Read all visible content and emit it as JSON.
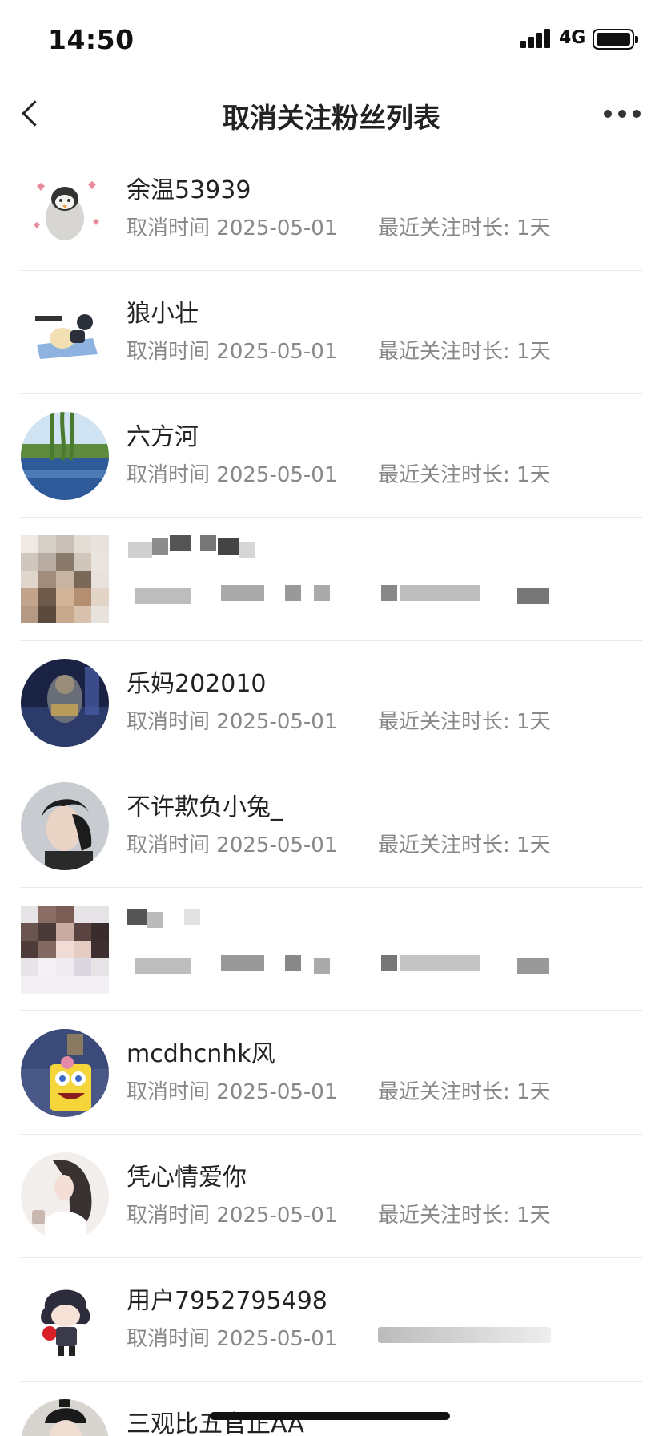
{
  "status_bar": {
    "time": "14:50",
    "network": "4G"
  },
  "nav": {
    "title": "取消关注粉丝列表"
  },
  "unfollow_label": "取消时间",
  "followers": [
    {
      "name": "余温53939",
      "date": "2025-05-01",
      "duration": "最近关注时长: 1天",
      "avatar_icon": "penguin-sticker"
    },
    {
      "name": "狼小壮",
      "date": "2025-05-01",
      "duration": "最近关注时长: 1天",
      "avatar_icon": "cartoon-sticker"
    },
    {
      "name": "六方河",
      "date": "2025-05-01",
      "duration": "最近关注时长: 1天",
      "avatar_icon": "lake-photo"
    },
    {
      "name": "",
      "date": "",
      "duration": "",
      "avatar_icon": "pixelated-avatar"
    },
    {
      "name": "乐妈202010",
      "date": "2025-05-01",
      "duration": "最近关注时长: 1天",
      "avatar_icon": "game-character"
    },
    {
      "name": "不许欺负小兔_",
      "date": "2025-05-01",
      "duration": "最近关注时长: 1天",
      "avatar_icon": "portrait-photo"
    },
    {
      "name": "",
      "date": "",
      "duration": "",
      "avatar_icon": "pixelated-avatar"
    },
    {
      "name": "mcdhcnhk风",
      "date": "2025-05-01",
      "duration": "最近关注时长: 1天",
      "avatar_icon": "spongebob-avatar"
    },
    {
      "name": "凭心情爱你",
      "date": "2025-05-01",
      "duration": "最近关注时长: 1天",
      "avatar_icon": "girl-illustration"
    },
    {
      "name": "用户7952795498",
      "date": "2025-05-01",
      "duration": "",
      "avatar_icon": "chibi-character"
    },
    {
      "name": "三观比五官正AA",
      "date": "",
      "duration": "",
      "avatar_icon": "portrait-photo"
    }
  ],
  "colors": {
    "separator": "#e8e8e8",
    "meta_text": "#888888",
    "name_text": "#222222"
  }
}
